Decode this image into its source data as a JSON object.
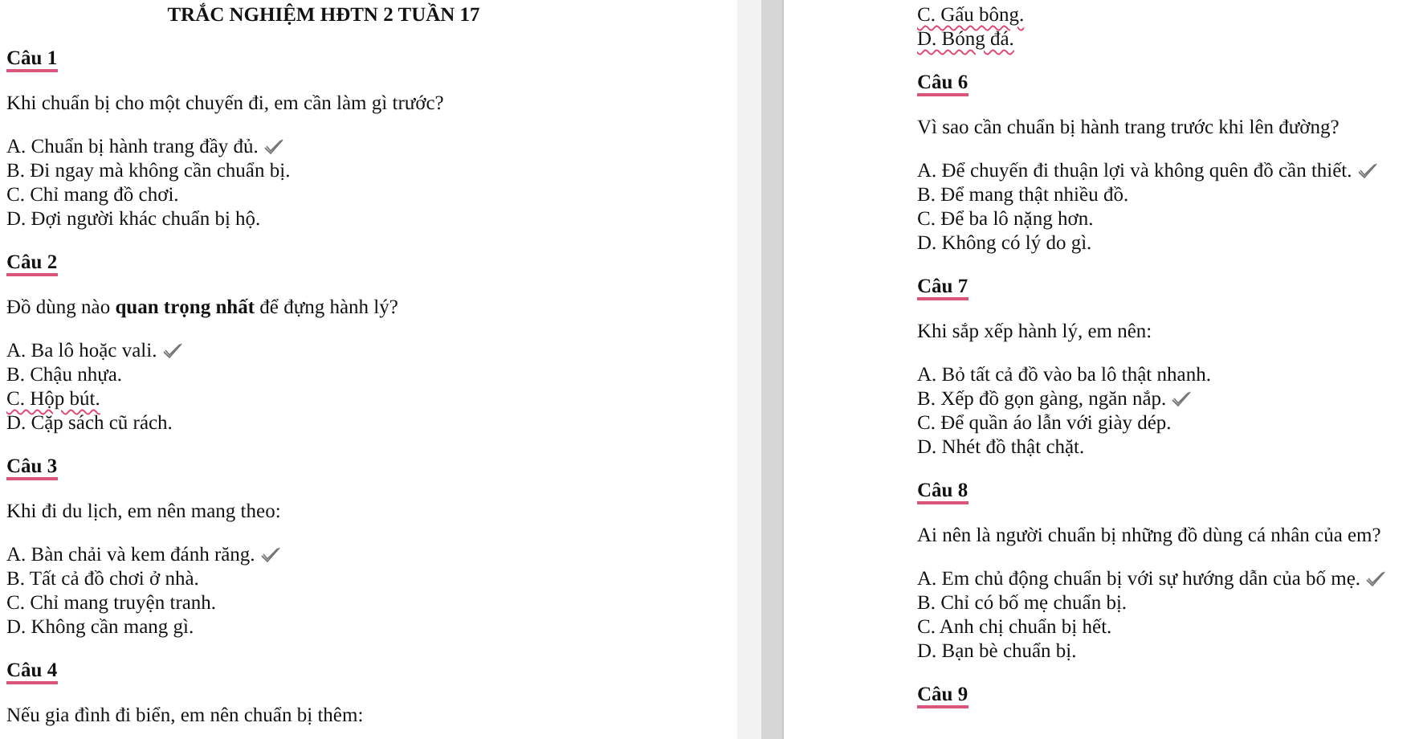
{
  "pages": [
    {
      "title": "TRẮC NGHIỆM HĐTN 2 TUẦN 17",
      "blocks": [
        {
          "heading": "Câu 1",
          "question": "Khi chuẩn bị cho một chuyến đi, em cần làm gì trước?",
          "options": [
            {
              "text": "A. Chuẩn bị hành trang đầy đủ.",
              "correct": true,
              "misspelled": false
            },
            {
              "text": "B. Đi ngay mà không cần chuẩn bị.",
              "correct": false,
              "misspelled": false
            },
            {
              "text": "C. Chỉ mang đồ chơi.",
              "correct": false,
              "misspelled": false
            },
            {
              "text": "D. Đợi người khác chuẩn bị hộ.",
              "correct": false,
              "misspelled": false
            }
          ]
        },
        {
          "heading": "Câu 2",
          "question": "Đồ dùng nào **quan trọng nhất** để đựng hành lý?",
          "options": [
            {
              "text": "A. Ba lô hoặc vali.",
              "correct": true,
              "misspelled": false
            },
            {
              "text": "B. Chậu nhựa.",
              "correct": false,
              "misspelled": false
            },
            {
              "text": "C. Hộp bút.",
              "correct": false,
              "misspelled": true
            },
            {
              "text": "D. Cặp sách cũ rách.",
              "correct": false,
              "misspelled": false
            }
          ]
        },
        {
          "heading": "Câu 3",
          "question": "Khi đi du lịch, em nên mang theo:",
          "options": [
            {
              "text": "A. Bàn chải và kem đánh răng.",
              "correct": true,
              "misspelled": false
            },
            {
              "text": "B. Tất cả đồ chơi ở nhà.",
              "correct": false,
              "misspelled": false
            },
            {
              "text": "C. Chỉ mang truyện tranh.",
              "correct": false,
              "misspelled": false
            },
            {
              "text": "D. Không cần mang gì.",
              "correct": false,
              "misspelled": false
            }
          ]
        },
        {
          "heading": "Câu 4",
          "question": "Nếu gia đình đi biển, em nên chuẩn bị thêm:"
        }
      ]
    },
    {
      "blocks": [
        {
          "options": [
            {
              "text": "C. Gấu bông.",
              "correct": false,
              "misspelled": true
            },
            {
              "text": "D. Bóng đá.",
              "correct": false,
              "misspelled": true
            }
          ]
        },
        {
          "heading": "Câu 6",
          "question": "Vì sao cần chuẩn bị hành trang trước khi lên đường?",
          "options": [
            {
              "text": "A. Để chuyến đi thuận lợi và không quên đồ cần thiết.",
              "correct": true,
              "misspelled": false
            },
            {
              "text": "B. Để mang thật nhiều đồ.",
              "correct": false,
              "misspelled": false
            },
            {
              "text": "C. Để ba lô nặng hơn.",
              "correct": false,
              "misspelled": false
            },
            {
              "text": "D. Không có lý do gì.",
              "correct": false,
              "misspelled": false
            }
          ]
        },
        {
          "heading": "Câu 7",
          "question": "Khi sắp xếp hành lý, em nên:",
          "options": [
            {
              "text": "A. Bỏ tất cả đồ vào ba lô thật nhanh.",
              "correct": false,
              "misspelled": false
            },
            {
              "text": "B. Xếp đồ gọn gàng, ngăn nắp.",
              "correct": true,
              "misspelled": false
            },
            {
              "text": "C. Để quần áo lẫn với giày dép.",
              "correct": false,
              "misspelled": false
            },
            {
              "text": "D. Nhét đồ thật chặt.",
              "correct": false,
              "misspelled": false
            }
          ]
        },
        {
          "heading": "Câu 8",
          "question": "Ai nên là người chuẩn bị những đồ dùng cá nhân của em?",
          "options": [
            {
              "text": "A. Em chủ động chuẩn bị với sự hướng dẫn của bố mẹ.",
              "correct": true,
              "misspelled": false
            },
            {
              "text": "B. Chỉ có bố mẹ chuẩn bị.",
              "correct": false,
              "misspelled": false
            },
            {
              "text": "C. Anh chị chuẩn bị hết.",
              "correct": false,
              "misspelled": false
            },
            {
              "text": "D. Bạn bè chuẩn bị.",
              "correct": false,
              "misspelled": false
            }
          ]
        },
        {
          "heading": "Câu 9"
        }
      ]
    }
  ]
}
